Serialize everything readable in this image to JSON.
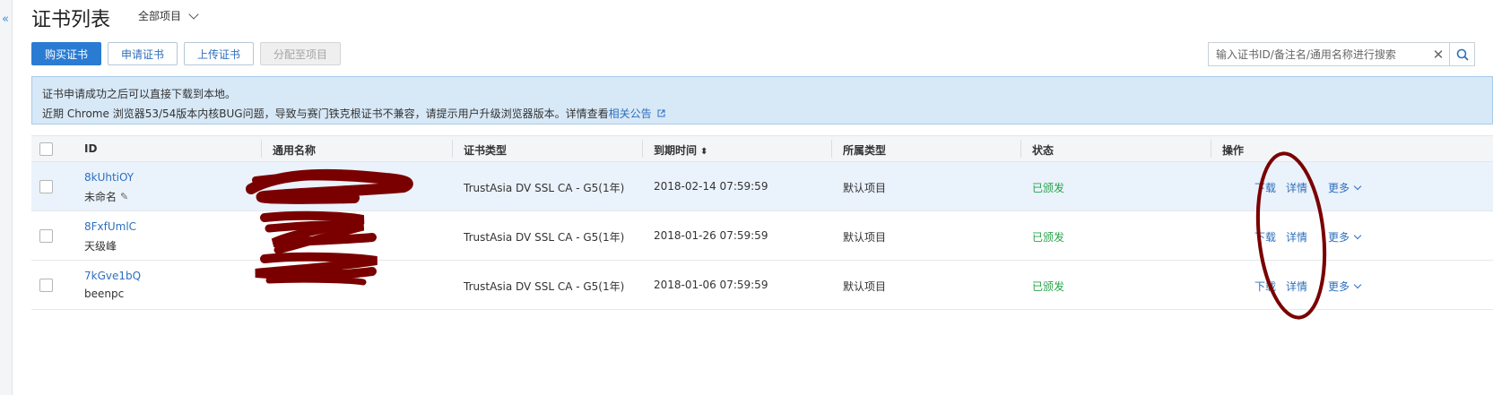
{
  "sidebar": {
    "collapse_icon": "double-chevron-left-icon"
  },
  "header": {
    "title": "证书列表",
    "project_filter": "全部项目"
  },
  "toolbar": {
    "buy_label": "购买证书",
    "apply_label": "申请证书",
    "upload_label": "上传证书",
    "assign_label": "分配至项目"
  },
  "search": {
    "placeholder": "输入证书ID/备注名/通用名称进行搜索",
    "value": ""
  },
  "notice": {
    "line1": "证书申请成功之后可以直接下载到本地。",
    "line2_prefix": "近期 Chrome 浏览器53/54版本内核BUG问题，导致与赛门铁克根证书不兼容，请提示用户升级浏览器版本。详情查看",
    "line2_link": "相关公告"
  },
  "table": {
    "columns": [
      "ID",
      "通用名称",
      "证书类型",
      "到期时间",
      "所属类型",
      "状态",
      "操作"
    ],
    "rows": [
      {
        "id": "8kUhtiOY",
        "remark": "未命名",
        "common_name": "",
        "cert_type": "TrustAsia DV SSL CA - G5(1年)",
        "expire": "2018-02-14 07:59:59",
        "belong": "默认项目",
        "status": "已颁发",
        "download": "下载",
        "detail": "详情",
        "more": "更多"
      },
      {
        "id": "8FxfUmlC",
        "remark": "天级峰",
        "common_name": "",
        "cert_type": "TrustAsia DV SSL CA - G5(1年)",
        "expire": "2018-01-26 07:59:59",
        "belong": "默认项目",
        "status": "已颁发",
        "download": "下载",
        "detail": "详情",
        "more": "更多"
      },
      {
        "id": "7kGve1bQ",
        "remark": "beenpc",
        "common_name": "",
        "cert_type": "TrustAsia DV SSL CA - G5(1年)",
        "expire": "2018-01-06 07:59:59",
        "belong": "默认项目",
        "status": "已颁发",
        "download": "下载",
        "detail": "详情",
        "more": "更多"
      }
    ]
  },
  "colors": {
    "accent": "#2a7cd3",
    "link": "#2e6fbd",
    "success": "#27a34a",
    "notice_bg": "#d7e8f7",
    "redaction": "#7a0000"
  }
}
